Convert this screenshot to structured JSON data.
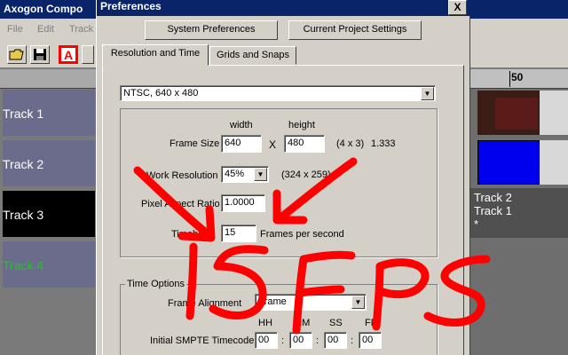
{
  "app": {
    "title": "Axogon Compo",
    "menu": [
      "File",
      "Edit",
      "Track"
    ],
    "ruler_label": "50",
    "tracks": [
      {
        "label": "Track 1",
        "color": "#ffffff",
        "bg": "#6b6b8c"
      },
      {
        "label": "Track 2",
        "color": "#ffffff",
        "bg": "#6b6b8c"
      },
      {
        "label": "Track 3",
        "color": "#ffffff",
        "bg": "#000000"
      },
      {
        "label": "Track 4",
        "color": "#22c322",
        "bg": "#6b6b8c"
      }
    ],
    "clip_info": [
      "Track 2",
      "Track 1",
      "*"
    ]
  },
  "dialog": {
    "title": "Preferences",
    "close_label": "X",
    "top_buttons": [
      "System Preferences",
      "Current Project Settings"
    ],
    "tabs": [
      "Resolution and Time",
      "Grids and Snaps"
    ],
    "preset": "NTSC, 640 x 480",
    "col_width": "width",
    "col_height": "height",
    "frame_size_label": "Frame Size",
    "width_value": "640",
    "times_sign": "X",
    "height_value": "480",
    "aspect_text": "(4 x 3)",
    "aspect_ratio": "1.333",
    "work_res_label": "Work Resolution",
    "work_res_value": "45%",
    "work_res_dims": "(324 x 259)",
    "pixel_aspect_label": "Pixel Aspect Ratio",
    "pixel_aspect_value": "1.0000",
    "timebase_label": "Timebase",
    "fps_value": "15",
    "fps_unit": "Frames per second",
    "time_options_label": "Time Options",
    "frame_alignment_label": "Frame Alignment",
    "frame_alignment_value": "Frame",
    "smpte_label": "Initial SMPTE Timecode",
    "smpte_headers": [
      "HH",
      "MM",
      "SS",
      "FF"
    ],
    "smpte_values": [
      "00",
      "00",
      "00",
      "00"
    ],
    "smpte_sep": ":"
  },
  "annotation": {
    "text": "15FPS",
    "color": "#ff0000"
  },
  "colors": {
    "title_bar": "#0a246a",
    "dialog_face": "#d4d0c8"
  }
}
